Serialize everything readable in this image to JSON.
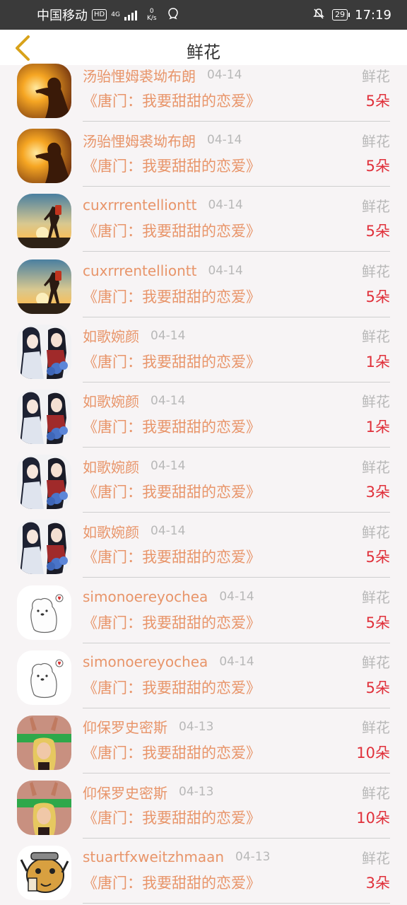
{
  "status_bar": {
    "carrier": "中国移动",
    "hd_badge": "HD",
    "network": "4G",
    "speed_value": "0",
    "speed_unit": "K/s",
    "battery": "29",
    "time": "17:19"
  },
  "header": {
    "title": "鲜花"
  },
  "colors": {
    "accent_orange": "#e8956a",
    "amount_red": "#e0303a",
    "muted_gray": "#b8b8b8",
    "back_arrow": "#d8a21a"
  },
  "items": [
    {
      "avatar": "sunset-girl-avatar",
      "username": "汤骀悝姆裘坳布朗",
      "date": "04-14",
      "gift": "鲜花",
      "book": "《唐门：我要甜甜的恋爱》",
      "amount": "5朵"
    },
    {
      "avatar": "sunset-girl-avatar",
      "username": "汤骀悝姆裘坳布朗",
      "date": "04-14",
      "gift": "鲜花",
      "book": "《唐门：我要甜甜的恋爱》",
      "amount": "5朵"
    },
    {
      "avatar": "sunset-hiker-avatar",
      "username": "cuxrrrentelliontt",
      "date": "04-14",
      "gift": "鲜花",
      "book": "《唐门：我要甜甜的恋爱》",
      "amount": "5朵"
    },
    {
      "avatar": "sunset-hiker-avatar",
      "username": "cuxrrrentelliontt",
      "date": "04-14",
      "gift": "鲜花",
      "book": "《唐门：我要甜甜的恋爱》",
      "amount": "5朵"
    },
    {
      "avatar": "anime-couple-avatar",
      "username": "如歌婉颜",
      "date": "04-14",
      "gift": "鲜花",
      "book": "《唐门：我要甜甜的恋爱》",
      "amount": "1朵"
    },
    {
      "avatar": "anime-couple-avatar",
      "username": "如歌婉颜",
      "date": "04-14",
      "gift": "鲜花",
      "book": "《唐门：我要甜甜的恋爱》",
      "amount": "1朵"
    },
    {
      "avatar": "anime-couple-avatar",
      "username": "如歌婉颜",
      "date": "04-14",
      "gift": "鲜花",
      "book": "《唐门：我要甜甜的恋爱》",
      "amount": "3朵"
    },
    {
      "avatar": "anime-couple-avatar",
      "username": "如歌婉颜",
      "date": "04-14",
      "gift": "鲜花",
      "book": "《唐门：我要甜甜的恋爱》",
      "amount": "5朵"
    },
    {
      "avatar": "white-bear-avatar",
      "username": "simonoereyochea",
      "date": "04-14",
      "gift": "鲜花",
      "book": "《唐门：我要甜甜的恋爱》",
      "amount": "5朵"
    },
    {
      "avatar": "white-bear-avatar",
      "username": "simonoereyochea",
      "date": "04-14",
      "gift": "鲜花",
      "book": "《唐门：我要甜甜的恋爱》",
      "amount": "5朵"
    },
    {
      "avatar": "blonde-singer-avatar",
      "username": "仰保罗史密斯",
      "date": "04-13",
      "gift": "鲜花",
      "book": "《唐门：我要甜甜的恋爱》",
      "amount": "10朵"
    },
    {
      "avatar": "blonde-singer-avatar",
      "username": "仰保罗史密斯",
      "date": "04-13",
      "gift": "鲜花",
      "book": "《唐门：我要甜甜的恋爱》",
      "amount": "10朵"
    },
    {
      "avatar": "cartoon-face-avatar",
      "username": "stuartfxweitzhmaan",
      "date": "04-13",
      "gift": "鲜花",
      "book": "《唐门：我要甜甜的恋爱》",
      "amount": "3朵"
    }
  ]
}
